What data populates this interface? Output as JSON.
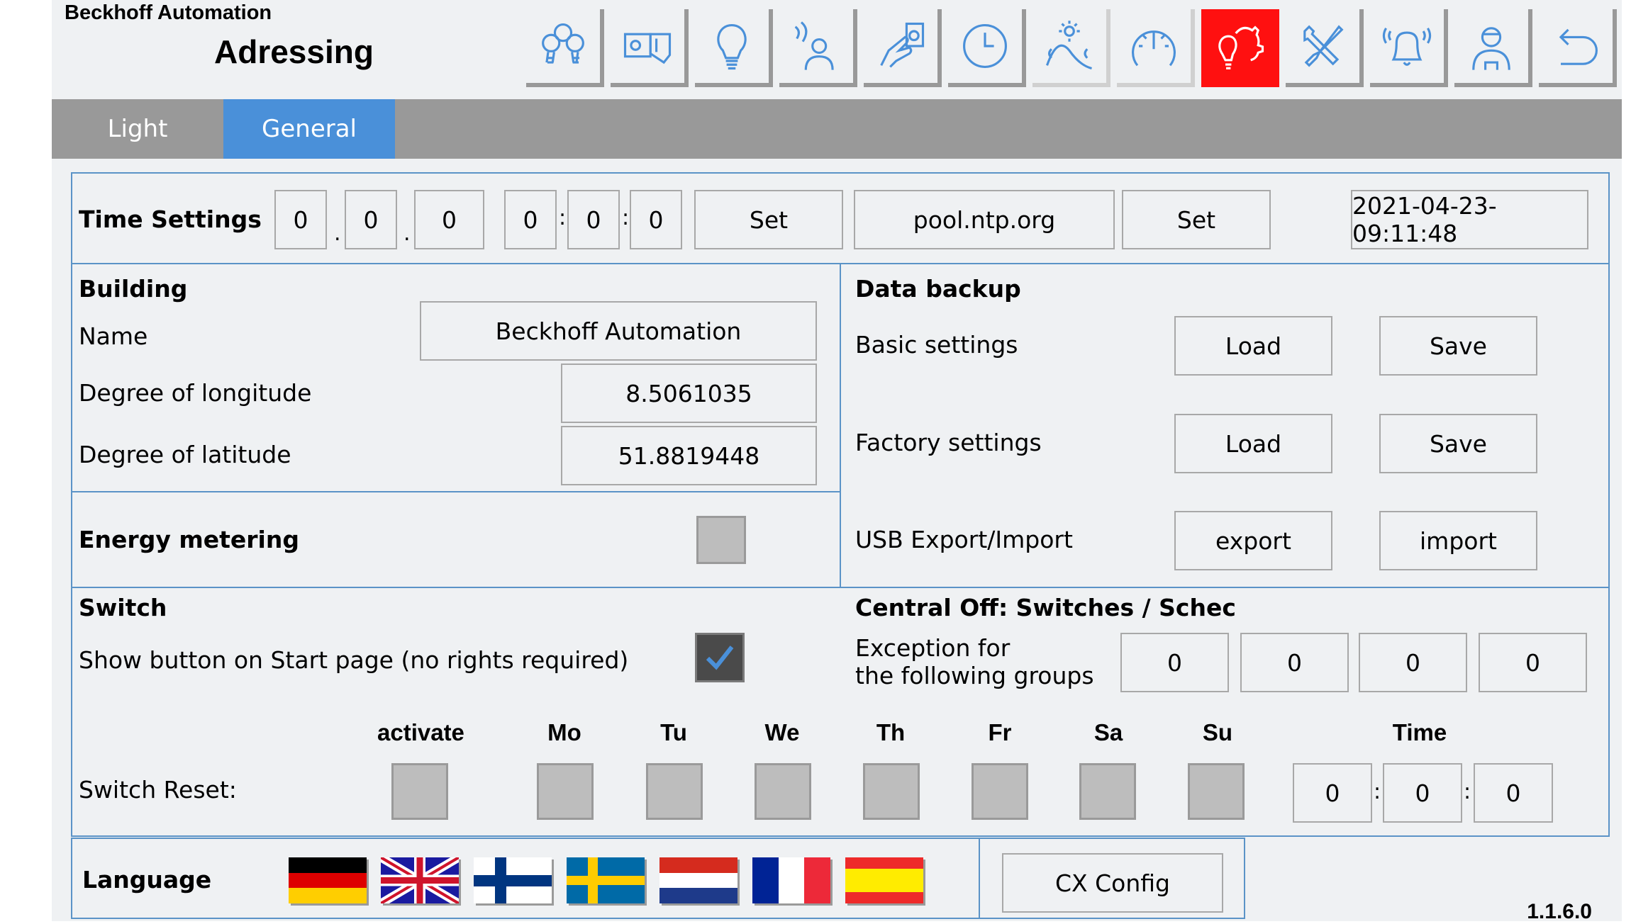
{
  "header": {
    "brand": "Beckhoff Automation",
    "page_title": "Adressing"
  },
  "nav": [
    {
      "name": "light-groups-icon",
      "state": "normal"
    },
    {
      "name": "switch-icon",
      "state": "normal"
    },
    {
      "name": "light-bulb-icon",
      "state": "normal"
    },
    {
      "name": "presence-sensor-icon",
      "state": "normal"
    },
    {
      "name": "push-button-icon",
      "state": "normal"
    },
    {
      "name": "clock-icon",
      "state": "normal"
    },
    {
      "name": "daylight-icon",
      "state": "light"
    },
    {
      "name": "gauge-icon",
      "state": "light"
    },
    {
      "name": "settings-icon",
      "state": "active"
    },
    {
      "name": "tools-icon",
      "state": "normal"
    },
    {
      "name": "alarm-bell-icon",
      "state": "normal"
    },
    {
      "name": "user-icon",
      "state": "normal"
    },
    {
      "name": "back-icon",
      "state": "normal"
    }
  ],
  "tabs": [
    {
      "label": "Light",
      "active": false
    },
    {
      "label": "General",
      "active": true
    }
  ],
  "time_settings": {
    "label": "Time Settings",
    "date": {
      "day": "0",
      "month": "0",
      "year": "0",
      "sep": "."
    },
    "time": {
      "hour": "0",
      "minute": "0",
      "second": "0",
      "sep": ":"
    },
    "set_label": "Set",
    "ntp_server": "pool.ntp.org",
    "ntp_set_label": "Set",
    "current_datetime": "2021-04-23-09:11:48"
  },
  "building": {
    "title": "Building",
    "name_label": "Name",
    "name_value": "Beckhoff Automation",
    "longitude_label": "Degree of longitude",
    "longitude_value": "8.5061035",
    "latitude_label": "Degree of latitude",
    "latitude_value": "51.8819448"
  },
  "energy": {
    "title": "Energy metering",
    "checked": false
  },
  "backup": {
    "title": "Data backup",
    "rows": [
      {
        "label": "Basic settings",
        "btn1": "Load",
        "btn2": "Save"
      },
      {
        "label": "Factory settings",
        "btn1": "Load",
        "btn2": "Save"
      },
      {
        "label": "USB Export/Import",
        "btn1": "export",
        "btn2": "import"
      }
    ]
  },
  "switch": {
    "title": "Switch",
    "show_button_label": "Show button on Start page (no rights required)",
    "show_button_checked": true,
    "reset_label": "Switch Reset:",
    "columns": [
      "activate",
      "Mo",
      "Tu",
      "We",
      "Th",
      "Fr",
      "Sa",
      "Su"
    ],
    "checked": [
      false,
      false,
      false,
      false,
      false,
      false,
      false,
      false
    ],
    "time_label": "Time",
    "time": {
      "hour": "0",
      "minute": "0",
      "second": "0",
      "sep": ":"
    }
  },
  "central_off": {
    "title": "Central Off: Switches / Schec",
    "exception_line1": "Exception for",
    "exception_line2": "the following groups",
    "groups": [
      "0",
      "0",
      "0",
      "0"
    ]
  },
  "language": {
    "label": "Language",
    "flags": [
      "German",
      "English",
      "Finnish",
      "Swedish",
      "Dutch",
      "French",
      "Spanish"
    ]
  },
  "cx_config_label": "CX Config",
  "version": "1.1.6.0",
  "colors": {
    "accent": "#4a90d9",
    "active_nav": "#ff1010",
    "tabbar": "#999999",
    "panel_border": "#5b93c7",
    "background": "#eff1f3"
  }
}
